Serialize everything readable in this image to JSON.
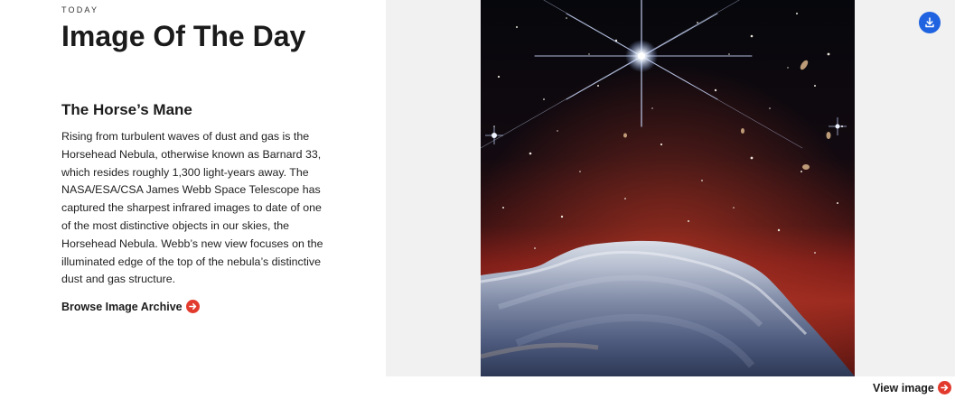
{
  "section": {
    "eyebrow": "TODAY",
    "title": "Image Of The Day"
  },
  "article": {
    "title": "The Horse’s Mane",
    "body": "Rising from turbulent waves of dust and gas is the Horsehead Nebula, otherwise known as Barnard 33, which resides roughly 1,300 light-years away. The NASA/ESA/CSA James Webb Space Telescope has captured the sharpest infrared images to date of one of the most distinctive objects in our skies, the Horsehead Nebula. Webb’s new view focuses on the illuminated edge of the top of the nebula’s distinctive dust and gas structure.",
    "browse_label": "Browse Image Archive"
  },
  "image": {
    "view_label": "View image",
    "download_icon": "download-icon",
    "arrow_icon": "arrow-right-circle-icon"
  },
  "colors": {
    "accent_red": "#e23b2e",
    "download_blue": "#1f63e0",
    "panel_bg": "#f1f1f1",
    "text": "#1b1b1b"
  }
}
